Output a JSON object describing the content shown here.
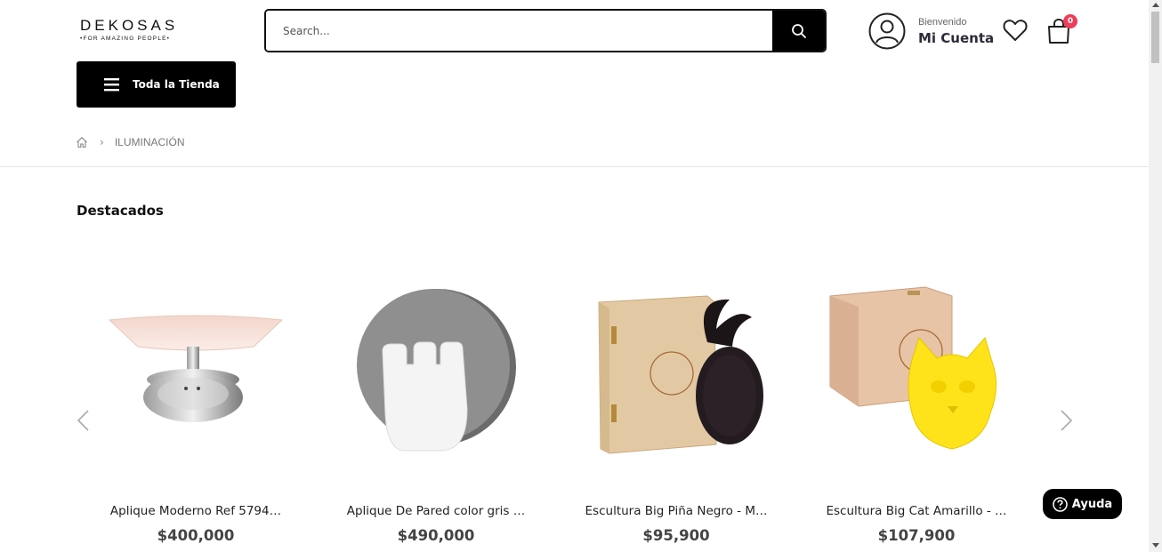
{
  "header": {
    "logo_main": "DEKOSAS",
    "logo_sub": "•FOR AMAZING PEOPLE•",
    "search_placeholder": "Search...",
    "welcome": "Bienvenido",
    "account": "Mi Cuenta",
    "cart_count": "0",
    "all_store": "Toda la Tienda"
  },
  "breadcrumb": {
    "home_icon": "home-icon",
    "current": "ILUMINACIÓN"
  },
  "section": {
    "title": "Destacados"
  },
  "products": [
    {
      "name": "Aplique Moderno Ref 5794…",
      "price": "$400,000"
    },
    {
      "name": "Aplique De Pared color gris …",
      "price": "$490,000"
    },
    {
      "name": "Escultura Big Piña Negro - M…",
      "price": "$95,900"
    },
    {
      "name": "Escultura Big Cat Amarillo - …",
      "price": "$107,900"
    }
  ],
  "help": {
    "label": "Ayuda"
  },
  "colors": {
    "accent": "#000000",
    "badge": "#ee3d5a"
  }
}
